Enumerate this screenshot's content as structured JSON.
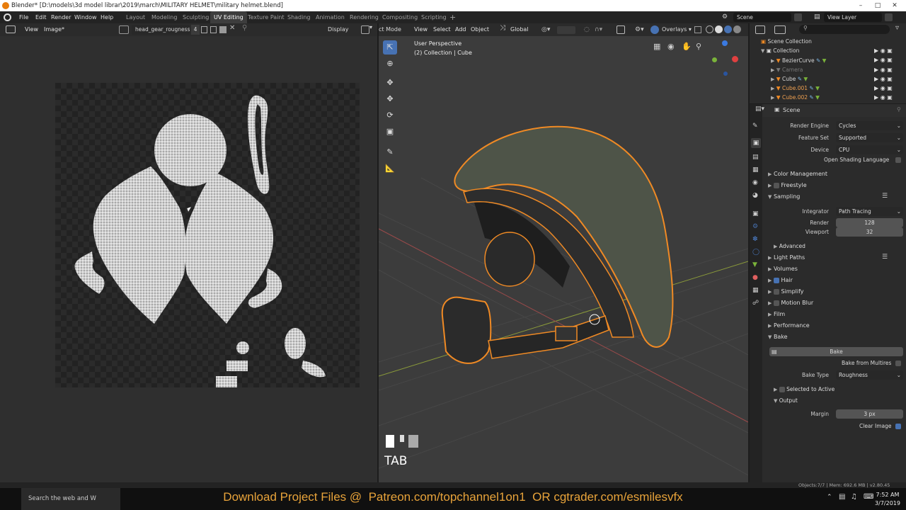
{
  "window": {
    "title": "Blender* [D:\\models\\3d model librar\\2019\\march\\MILITARY HELMET\\military helmet.blend]"
  },
  "menu": [
    "File",
    "Edit",
    "Render",
    "Window",
    "Help"
  ],
  "workspaces": [
    "Layout",
    "Modeling",
    "Sculpting",
    "UV Editing",
    "Texture Paint",
    "Shading",
    "Animation",
    "Rendering",
    "Compositing",
    "Scripting"
  ],
  "active_workspace": "UV Editing",
  "scene_label": "Scene",
  "view_layer_label": "View Layer",
  "image_editor": {
    "view_menu": "View",
    "image_menu": "Image*",
    "image_name": "head_gear_rougness...",
    "users": "4",
    "display_label": "Display"
  },
  "viewport": {
    "mode": "ct Mode",
    "menus": [
      "View",
      "Select",
      "Add",
      "Object"
    ],
    "orientation": "Global",
    "overlays": "Overlays",
    "perspective": "User Perspective",
    "collection_info": "(2) Collection | Cube",
    "key_hint": "TAB"
  },
  "outliner": {
    "root": "Scene Collection",
    "collection": "Collection",
    "items": [
      "BezierCurve",
      "Camera",
      "Cube",
      "Cube.001",
      "Cube.002"
    ]
  },
  "properties": {
    "scene": "Scene",
    "render_engine_label": "Render Engine",
    "render_engine": "Cycles",
    "feature_set_label": "Feature Set",
    "feature_set": "Supported",
    "device_label": "Device",
    "device": "CPU",
    "osl": "Open Shading Language",
    "color_management": "Color Management",
    "freestyle": "Freestyle",
    "sampling": "Sampling",
    "integrator_label": "Integrator",
    "integrator": "Path Tracing",
    "render_label": "Render",
    "render_samples": "128",
    "viewport_label": "Viewport",
    "viewport_samples": "32",
    "advanced": "Advanced",
    "light_paths": "Light Paths",
    "volumes": "Volumes",
    "hair": "Hair",
    "simplify": "Simplify",
    "motion_blur": "Motion Blur",
    "film": "Film",
    "performance": "Performance",
    "bake": "Bake",
    "bake_button": "Bake",
    "bake_from_multires": "Bake from Multires",
    "bake_type_label": "Bake Type",
    "bake_type": "Roughness",
    "selected_to_active": "Selected to Active",
    "output": "Output",
    "margin_label": "Margin",
    "margin": "3 px",
    "clear_image": "Clear Image"
  },
  "status": {
    "stats": "Objects:7/7 | Mem: 692.6 MB | v2.80.45"
  },
  "taskbar": {
    "search_placeholder": "Search the web and W",
    "time": "7:52 AM",
    "date": "3/7/2019"
  },
  "banner": "Download Project Files @  Patreon.com/topchannel1on1  OR cgtrader.com/esmilesvfx",
  "colors": {
    "accent": "#4772b3",
    "selection_orange": "#f08a24",
    "banner_text": "#e8a33a"
  }
}
